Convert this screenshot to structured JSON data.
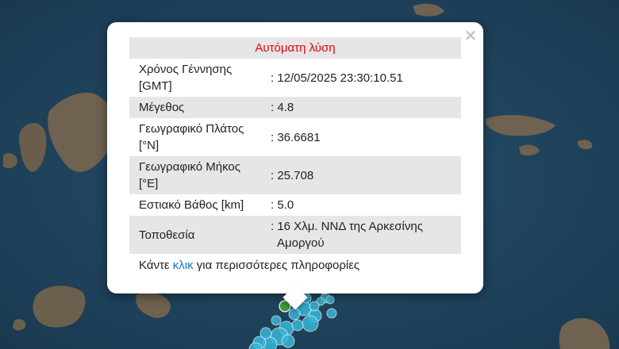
{
  "popup": {
    "close_symbol": "×",
    "title": "Αυτόματη λύση",
    "title_color": "#e8000b",
    "rows": [
      {
        "key_line1": "Χρόνος Γέννησης",
        "key_line2": "[GMT]",
        "value_line1": ": 12/05/2025 23:30:10.51",
        "value_line2": ""
      },
      {
        "key_line1": "Μέγεθος",
        "key_line2": "",
        "value_line1": ": 4.8",
        "value_line2": ""
      },
      {
        "key_line1": "Γεωγραφικό Πλάτος",
        "key_line2": "[°N]",
        "value_line1": ": 36.6681",
        "value_line2": ""
      },
      {
        "key_line1": "Γεωγραφικό Μήκος",
        "key_line2": "[°E]",
        "value_line1": ": 25.708",
        "value_line2": ""
      },
      {
        "key_line1": "Εστιακό Βάθος [km]",
        "key_line2": "",
        "value_line1": ": 5.0",
        "value_line2": ""
      },
      {
        "key_line1": "Τοποθεσία",
        "key_line2": "",
        "value_line1": ": 16 Χλμ. ΝΝΔ της Αρκεσίνης",
        "value_line2": "Αμοργού"
      }
    ],
    "more_prefix": "Κάντε ",
    "more_link": "κλικ",
    "more_suffix": " για περισσότερες πληροφορίες"
  },
  "map": {
    "sea_color": "#1d3e57",
    "land_color": "#6f6250",
    "marker_color": "#38b6d8",
    "marker_highlight_color": "#3f9a3a"
  }
}
